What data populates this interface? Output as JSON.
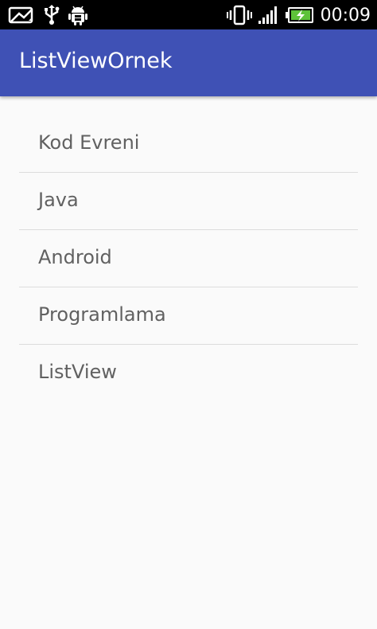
{
  "status_bar": {
    "time": "00:09",
    "left_icons": [
      "photo-icon",
      "usb-icon",
      "android-debug-icon"
    ],
    "right_icons": [
      "vibrate-icon",
      "signal-icon",
      "battery-charging-icon"
    ]
  },
  "app_bar": {
    "title": "ListViewOrnek",
    "color": "#3f51b5"
  },
  "list": {
    "items": [
      {
        "label": "Kod Evreni"
      },
      {
        "label": "Java"
      },
      {
        "label": "Android"
      },
      {
        "label": "Programlama"
      },
      {
        "label": "ListView"
      }
    ]
  }
}
